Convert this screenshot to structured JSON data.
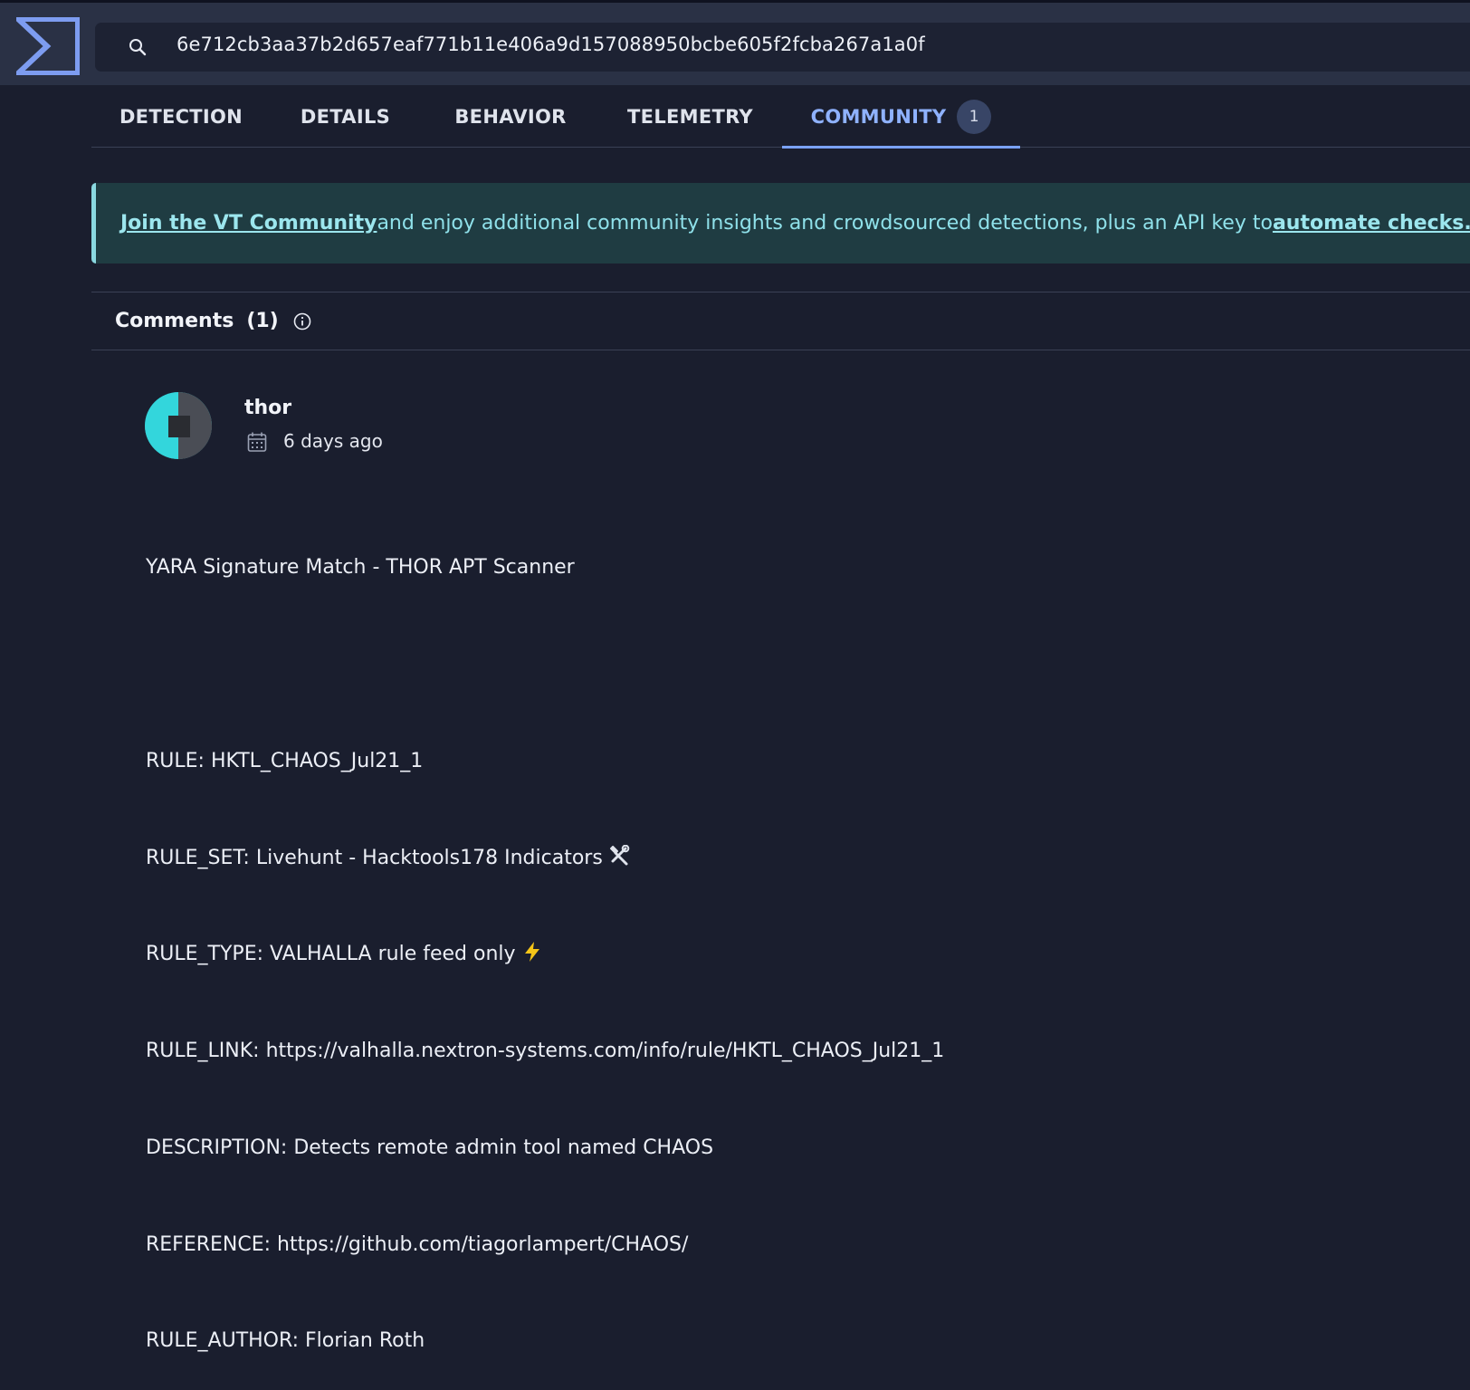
{
  "search": {
    "value": "6e712cb3aa37b2d657eaf771b11e406a9d157088950bcbe605f2fcba267a1a0f"
  },
  "tabs": [
    {
      "label": "DETECTION"
    },
    {
      "label": "DETAILS"
    },
    {
      "label": "BEHAVIOR"
    },
    {
      "label": "TELEMETRY"
    },
    {
      "label": "COMMUNITY",
      "badge": "1",
      "active": true
    }
  ],
  "banner": {
    "link1": "Join the VT Community",
    "text": " and enjoy additional community insights and crowdsourced detections, plus an API key to ",
    "link2": "automate checks."
  },
  "comments": {
    "title": "Comments",
    "count": "(1)"
  },
  "comment": {
    "author": "thor",
    "time": "6 days ago",
    "lines": [
      "YARA Signature Match - THOR APT Scanner",
      "",
      "RULE: HKTL_CHAOS_Jul21_1",
      "RULE_SET: Livehunt - Hacktools178 Indicators",
      "RULE_TYPE: VALHALLA rule feed only",
      "RULE_LINK: https://valhalla.nextron-systems.com/info/rule/HKTL_CHAOS_Jul21_1",
      "DESCRIPTION: Detects remote admin tool named CHAOS",
      "REFERENCE: https://github.com/tiagorlampert/CHAOS/",
      "RULE_AUTHOR: Florian Roth"
    ]
  },
  "icons": {
    "logo": "virustotal-logo",
    "search": "search-icon",
    "info": "info-icon",
    "calendar": "calendar-icon",
    "tools": "hammer-wrench-icon",
    "bolt": "lightning-icon"
  },
  "colors": {
    "accent": "#7aa2ff",
    "banner_bg": "#1f3c42",
    "banner_text": "#8fe1ea",
    "avatar": "#33d6dc"
  }
}
